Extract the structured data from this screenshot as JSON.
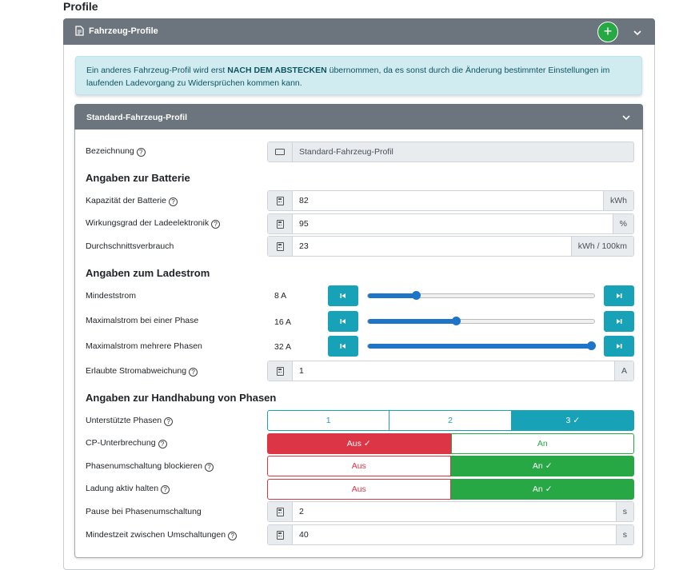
{
  "page": {
    "heading": "Profile"
  },
  "vehicle_profiles": {
    "title": "Fahrzeug-Profile",
    "add_symbol": "+",
    "alert": {
      "part1": "Ein anderes Fahrzeug-Profil wird erst ",
      "bold": "NACH DEM ABSTECKEN",
      "part2": " übernommen, da es sonst durch die Änderung bestimmter Einstellungen im laufenden Ladevorgang zu Widersprüchen kommen kann."
    }
  },
  "profile": {
    "title": "Standard-Fahrzeug-Profil",
    "name_label": "Bezeichnung",
    "name_value": "Standard-Fahrzeug-Profil",
    "battery": {
      "heading": "Angaben zur Batterie",
      "capacity_label": "Kapazität der Batterie",
      "capacity_value": "82",
      "capacity_unit": "kWh",
      "efficiency_label": "Wirkungsgrad der Ladeelektronik",
      "efficiency_value": "95",
      "efficiency_unit": "%",
      "consumption_label": "Durchschnittsverbrauch",
      "consumption_value": "23",
      "consumption_unit": "kWh / 100km"
    },
    "current": {
      "heading": "Angaben zum Ladestrom",
      "min_label": "Mindeststrom",
      "min_value": "8 A",
      "min_level": 0.21,
      "max1_label": "Maximalstrom bei einer Phase",
      "max1_value": "16 A",
      "max1_level": 0.39,
      "max3_label": "Maximalstrom mehrere Phasen",
      "max3_value": "32 A",
      "max3_level": 1.0,
      "deviation_label": "Erlaubte Stromabweichung",
      "deviation_value": "1",
      "deviation_unit": "A"
    },
    "phases": {
      "heading": "Angaben zur Handhabung von Phasen",
      "supported_label": "Unterstützte Phasen",
      "supported_options": [
        "1",
        "2",
        "3"
      ],
      "supported_selected": "3",
      "cp_label": "CP-Unterbrechung",
      "cp_selected": "Aus",
      "switch_block_label": "Phasenumschaltung blockieren",
      "switch_block_selected": "An",
      "keep_active_label": "Ladung aktiv halten",
      "keep_active_selected": "An",
      "off_label": "Aus",
      "on_label": "An",
      "pause_label": "Pause bei Phasenumschaltung",
      "pause_value": "2",
      "pause_unit": "s",
      "min_time_label": "Mindestzeit zwischen Umschaltungen",
      "min_time_value": "40",
      "min_time_unit": "s"
    }
  },
  "colors": {
    "header_gray": "#6c757d",
    "info": "#17a2b8",
    "success": "#28a745",
    "danger": "#dc3545",
    "slider": "#1e74c7"
  }
}
